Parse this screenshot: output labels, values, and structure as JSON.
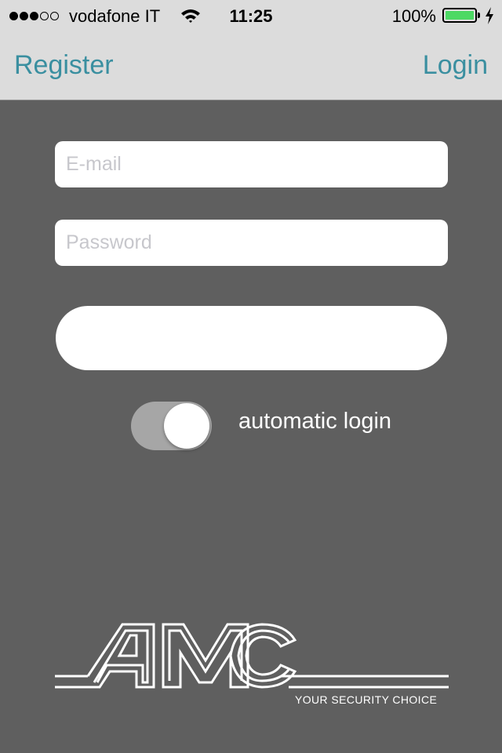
{
  "status_bar": {
    "carrier": "vodafone IT",
    "time": "11:25",
    "battery_percent": "100%",
    "signal_bars_filled": 3,
    "signal_bars_total": 5,
    "battery_level": 1.0,
    "battery_color": "#4cd964"
  },
  "nav": {
    "left_label": "Register",
    "right_label": "Login",
    "accent_color": "#3a8fa0"
  },
  "form": {
    "email": {
      "value": "",
      "placeholder": "E-mail"
    },
    "password": {
      "value": "",
      "placeholder": "Password"
    },
    "submit_label": "",
    "auto_login": {
      "label": "automatic login",
      "enabled": false
    }
  },
  "logo": {
    "brand": "AMC",
    "tagline": "YOUR SECURITY CHOICE"
  },
  "icons": {
    "signal": "signal-dots-icon",
    "wifi": "wifi-icon",
    "battery": "battery-icon",
    "charging": "charging-bolt-icon"
  }
}
